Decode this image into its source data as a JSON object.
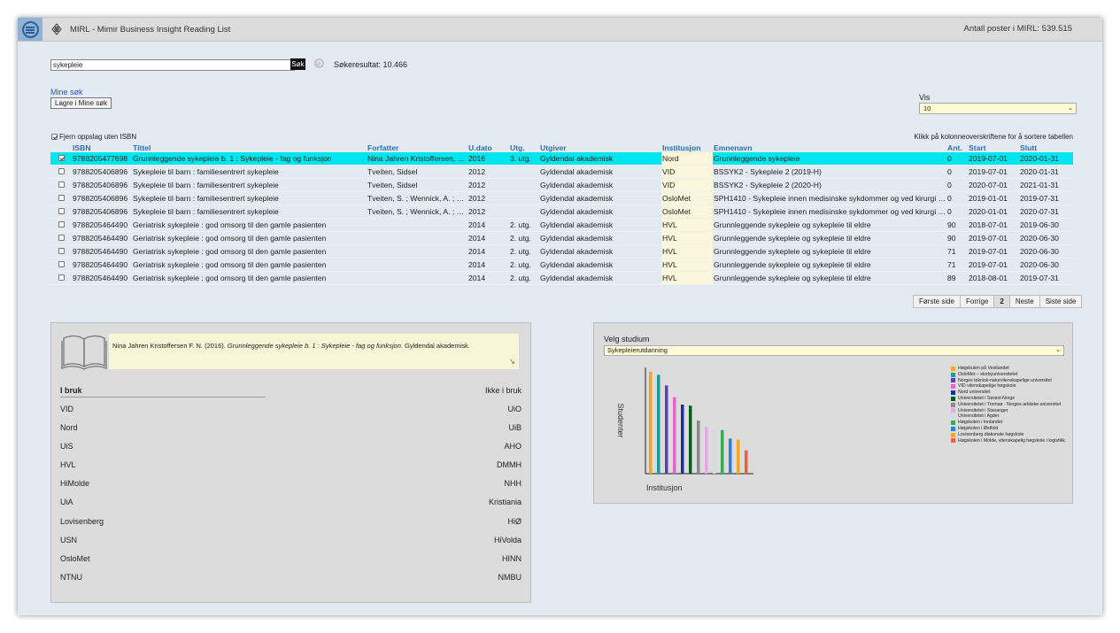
{
  "header": {
    "title": "MIRL - Mimir Business Insight Reading List",
    "count_text": "Antall poster i MIRL: 539.515"
  },
  "search": {
    "value": "sykepleie",
    "button_label": "Søk",
    "result_text": "Søkeresultat: 10.466"
  },
  "saved": {
    "link_label": "Mine søk",
    "save_button": "Lagre i Mine søk"
  },
  "vis": {
    "label": "Vis",
    "value": "10"
  },
  "filter": {
    "isbn_label": "Fjern oppslag uten ISBN",
    "isbn_checked": true,
    "sort_hint": "Klikk på kolonneoverskriftene for å sortere tabellen"
  },
  "table": {
    "headers": [
      "ISBN",
      "Tittel",
      "Forfatter",
      "U.dato",
      "Utg.",
      "Utgiver",
      "Institusjon",
      "Emnenavn",
      "Ant.",
      "Start",
      "Slutt"
    ],
    "rows": [
      {
        "checked": true,
        "isbn": "9788205477698",
        "title": "Grunnleggende sykepleie b. 1 : Sykepleie - fag og funksjon",
        "author": "Nina Jahren Kristoffersen, Fi...",
        "date": "2016",
        "ed": "3. utg.",
        "publisher": "Gyldendal akademisk",
        "inst": "Nord",
        "course": "Grunnleggende sykepleie",
        "ant": "0",
        "start": "2019-07-01",
        "end": "2020-01-31"
      },
      {
        "checked": false,
        "isbn": "9788205406896",
        "title": "Sykepleie til barn : familiesentrert sykepleie",
        "author": "Tveiten, Sidsel",
        "date": "2012",
        "ed": "",
        "publisher": "Gyldendal akademisk",
        "inst": "VID",
        "course": "BSSYK2 - Sykepleie 2 (2019-H)",
        "ant": "0",
        "start": "2019-07-01",
        "end": "2020-01-31"
      },
      {
        "checked": false,
        "isbn": "9788205406896",
        "title": "Sykepleie til barn : familiesentrert sykepleie",
        "author": "Tveiten, Sidsel",
        "date": "2012",
        "ed": "",
        "publisher": "Gyldendal akademisk",
        "inst": "VID",
        "course": "BSSYK2 - Sykepleie 2 (2020-H)",
        "ant": "0",
        "start": "2020-07-01",
        "end": "2021-01-31"
      },
      {
        "checked": false,
        "isbn": "9788205406896",
        "title": "Sykepleie til barn : familiesentrert sykepleie",
        "author": "Tveiten, S. ; Wennick, A. ; Ste...",
        "date": "2012",
        "ed": "",
        "publisher": "Gyldendal akademisk",
        "inst": "OsloMet",
        "course": "SPH1410 - Sykepleie innen medisinske sykdommer og ved kirurgi (2...",
        "ant": "0",
        "start": "2019-01-01",
        "end": "2019-07-31"
      },
      {
        "checked": false,
        "isbn": "9788205406896",
        "title": "Sykepleie til barn : familiesentrert sykepleie",
        "author": "Tveiten, S. ; Wennick, A. ; Ste...",
        "date": "2012",
        "ed": "",
        "publisher": "Gyldendal akademisk",
        "inst": "OsloMet",
        "course": "SPH1410 - Sykepleie innen medisinske sykdommer og ved kirurgi (2...",
        "ant": "0",
        "start": "2020-01-01",
        "end": "2020-07-31"
      },
      {
        "checked": false,
        "isbn": "9788205464490",
        "title": "Geriatrisk sykepleie : god omsorg til den gamle pasienten",
        "author": "",
        "date": "2014",
        "ed": "2. utg.",
        "publisher": "Gyldendal akademisk",
        "inst": "HVL",
        "course": "Grunnleggende sykepleie og sykepleie til eldre",
        "ant": "90",
        "start": "2018-07-01",
        "end": "2019-06-30"
      },
      {
        "checked": false,
        "isbn": "9788205464490",
        "title": "Geriatrisk sykepleie : god omsorg til den gamle pasienten",
        "author": "",
        "date": "2014",
        "ed": "2. utg.",
        "publisher": "Gyldendal akademisk",
        "inst": "HVL",
        "course": "Grunnleggende sykepleie og sykepleie til eldre",
        "ant": "90",
        "start": "2019-07-01",
        "end": "2020-06-30"
      },
      {
        "checked": false,
        "isbn": "9788205464490",
        "title": "Geriatrisk sykepleie : god omsorg til den gamle pasienten",
        "author": "",
        "date": "2014",
        "ed": "2. utg.",
        "publisher": "Gyldendal akademisk",
        "inst": "HVL",
        "course": "Grunnleggende sykepleie og sykepleie til eldre",
        "ant": "71",
        "start": "2019-07-01",
        "end": "2020-06-30"
      },
      {
        "checked": false,
        "isbn": "9788205464490",
        "title": "Geriatrisk sykepleie : god omsorg til den gamle pasienten",
        "author": "",
        "date": "2014",
        "ed": "2. utg.",
        "publisher": "Gyldendal akademisk",
        "inst": "HVL",
        "course": "Grunnleggende sykepleie og sykepleie til eldre",
        "ant": "71",
        "start": "2019-07-01",
        "end": "2020-06-30"
      },
      {
        "checked": false,
        "isbn": "9788205464490",
        "title": "Geriatrisk sykepleie : god omsorg til den gamle pasienten",
        "author": "",
        "date": "2014",
        "ed": "2. utg.",
        "publisher": "Gyldendal akademisk",
        "inst": "HVL",
        "course": "Grunnleggende sykepleie og sykepleie til eldre",
        "ant": "89",
        "start": "2018-08-01",
        "end": "2019-07-31"
      }
    ]
  },
  "pager": {
    "first": "Første side",
    "prev": "Forrige",
    "current": "2",
    "next": "Neste",
    "last": "Siste side"
  },
  "detail": {
    "citation_author": "Nina Jahren Kristoffersen F. N. (2016). ",
    "citation_title": "Grunnleggende sykepleie b. 1 : Sykepleie - fag og funksjon",
    "citation_tail": ". Gyldendal akademisk.",
    "in_use_label": "I bruk",
    "not_in_use_label": "Ikke i bruk",
    "in_use": [
      "VID",
      "Nord",
      "UiS",
      "HVL",
      "HiMolde",
      "UiA",
      "Lovisenberg",
      "USN",
      "OsloMet",
      "NTNU"
    ],
    "not_in_use": [
      "UiO",
      "UiB",
      "AHO",
      "DMMH",
      "NHH",
      "Kristiania",
      "HiØ",
      "HiVolda",
      "HINN",
      "NMBU"
    ]
  },
  "study": {
    "label": "Velg studium",
    "value": "Sykepleierutdanning"
  },
  "chart_data": {
    "type": "bar",
    "xlabel": "Institusjon",
    "ylabel": "Studenter",
    "series": [
      {
        "name": "Høgskulen på Vestlandet",
        "value": 96,
        "color": "#f5a623"
      },
      {
        "name": "OsloMet – storbyuniversitetet",
        "value": 93,
        "color": "#1a9a9a"
      },
      {
        "name": "Norges teknisk-naturvitenskapelige universitet",
        "value": 83,
        "color": "#5b3fb8"
      },
      {
        "name": "VID vitenskapelige høgskole",
        "value": 72,
        "color": "#e066c8"
      },
      {
        "name": "Nord universitet",
        "value": 65,
        "color": "#1c2ea0"
      },
      {
        "name": "Universitetet i Sørøst-Norge",
        "value": 64,
        "color": "#0b5d1e"
      },
      {
        "name": "Universitetet i Tromsø - Norges arktiske universitet",
        "value": 50,
        "color": "#8a8a8a"
      },
      {
        "name": "Universitetet i Stavanger",
        "value": 44,
        "color": "#e8a8e8"
      },
      {
        "name": "Universitetet i Agder",
        "value": 42,
        "color": "#d8d8e8"
      },
      {
        "name": "Høgskolen i Innlandet",
        "value": 41,
        "color": "#3aaa55"
      },
      {
        "name": "Høgskolen i Østfold",
        "value": 33,
        "color": "#2a7fe0"
      },
      {
        "name": "Lovisenberg diakonale høgskole",
        "value": 32,
        "color": "#f5a623"
      },
      {
        "name": "Høgskolen i Molde, vitenskapelig høgskole i logistikk",
        "value": 22,
        "color": "#f06040"
      }
    ]
  }
}
